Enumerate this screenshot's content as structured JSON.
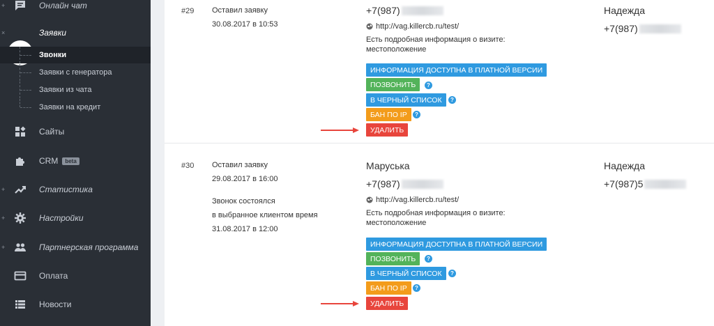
{
  "sidebar": {
    "items": [
      {
        "label": "Онлайн чат",
        "icon": "chat-icon"
      },
      {
        "label": "Заявки",
        "icon": "user-icon"
      },
      {
        "label": "Сайты",
        "icon": "sites-icon"
      },
      {
        "label": "CRM",
        "badge": "beta",
        "icon": "puzzle-icon"
      },
      {
        "label": "Статистика",
        "icon": "trend-icon"
      },
      {
        "label": "Настройки",
        "icon": "gear-icon"
      },
      {
        "label": "Партнерская программа",
        "icon": "users-icon"
      },
      {
        "label": "Оплата",
        "icon": "card-icon"
      },
      {
        "label": "Новости",
        "icon": "list-icon"
      }
    ],
    "subitems": [
      {
        "label": "Звонки"
      },
      {
        "label": "Заявки с генератора"
      },
      {
        "label": "Заявки из чата"
      },
      {
        "label": "Заявки на кредит"
      }
    ]
  },
  "requests": [
    {
      "number": "#29",
      "action": "Оставил заявку",
      "date": "30.08.2017 в 10:53",
      "name": "",
      "phone_prefix": "+7(987)",
      "site": "http://vag.killercb.ru/test/",
      "info_line1": "Есть подробная информация о визите:",
      "info_line2": "местоположение",
      "contact_name": "Надежда",
      "contact_phone_prefix": "+7(987)"
    },
    {
      "number": "#30",
      "action": "Оставил заявку",
      "date": "29.08.2017 в 16:00",
      "note_line1": "Звонок состоялся",
      "note_line2": "в выбранное клиентом время",
      "note_line3": "31.08.2017 в 12:00",
      "name": "Маруська",
      "phone_prefix": "+7(987)",
      "site": "http://vag.killercb.ru/test/",
      "info_line1": "Есть подробная информация о визите:",
      "info_line2": "местоположение",
      "contact_name": "Надежда",
      "contact_phone_prefix": "+7(987)5"
    }
  ],
  "buttons": {
    "info_paid": "ИНФОРМАЦИЯ ДОСТУПНА В ПЛАТНОЙ ВЕРСИИ",
    "call": "ПОЗВОНИТЬ",
    "blacklist": "В ЧЕРНЫЙ СПИСОК",
    "ban_ip": "БАН ПО IP",
    "delete": "УДАЛИТЬ",
    "help": "?"
  },
  "colors": {
    "sidebar_bg": "#2a2f36",
    "blue": "#2f9ae0",
    "green": "#53b35a",
    "orange": "#f39c1b",
    "red": "#e8453c"
  }
}
